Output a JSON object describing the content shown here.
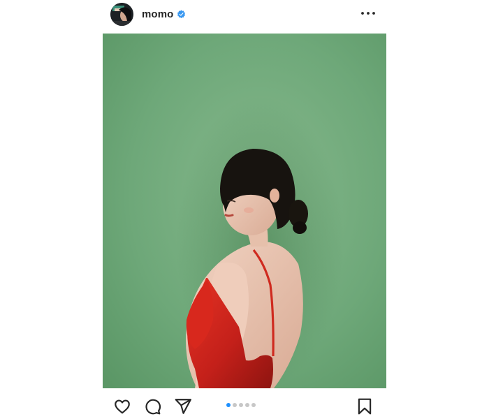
{
  "post": {
    "username": "momo",
    "verified": true,
    "accent_color": "#3897f0",
    "carousel": {
      "total": 5,
      "active_index": 1
    },
    "actions": [
      "heart-icon",
      "comment-icon",
      "share-icon",
      "bookmark-icon"
    ],
    "more_icon": "more-options-icon"
  }
}
